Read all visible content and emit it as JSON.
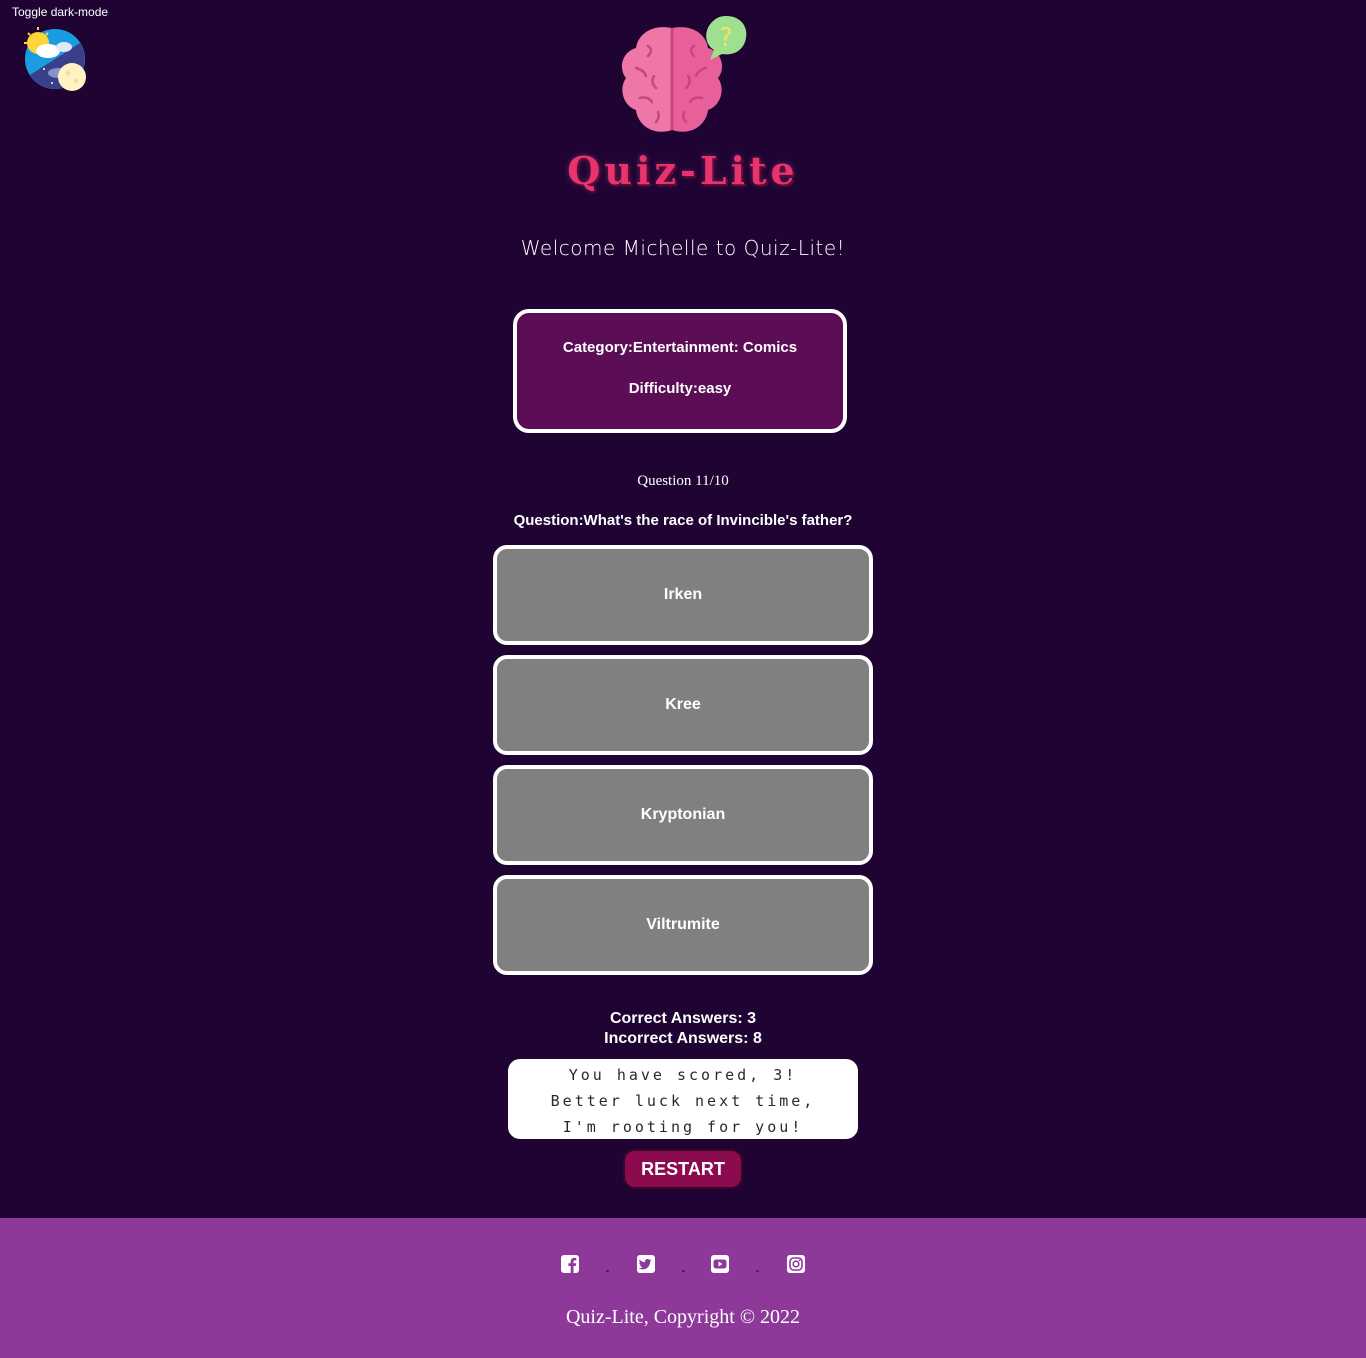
{
  "darkmode": {
    "label": "Toggle dark-mode",
    "icon": "day-night-icon"
  },
  "header": {
    "logo_icon": "brain-question-icon",
    "brand": "Quiz-Lite",
    "welcome": "Welcome Michelle to Quiz-Lite!"
  },
  "info": {
    "category": "Category:Entertainment: Comics",
    "difficulty": "Difficulty:easy"
  },
  "quiz": {
    "progress": "Question 11/10",
    "question": "Question:What's the race of Invincible's father?",
    "answers": [
      "Irken",
      "Kree",
      "Kryptonian",
      "Viltrumite"
    ]
  },
  "score": {
    "correct": "Correct Answers: 3",
    "incorrect": "Incorrect Answers: 8",
    "message": "You have scored, 3! Better luck next time, I'm rooting for you!"
  },
  "restart_label": "RESTART",
  "footer": {
    "social": [
      "facebook-icon",
      "twitter-icon",
      "youtube-icon",
      "instagram-icon"
    ],
    "copyright": "Quiz-Lite, Copyright © 2022"
  },
  "colors": {
    "background": "#1f0433",
    "brand": "#e8336d",
    "card": "#5b0e55",
    "answer": "#808080",
    "restart": "#8c0a4e",
    "footer": "#8e399a"
  }
}
